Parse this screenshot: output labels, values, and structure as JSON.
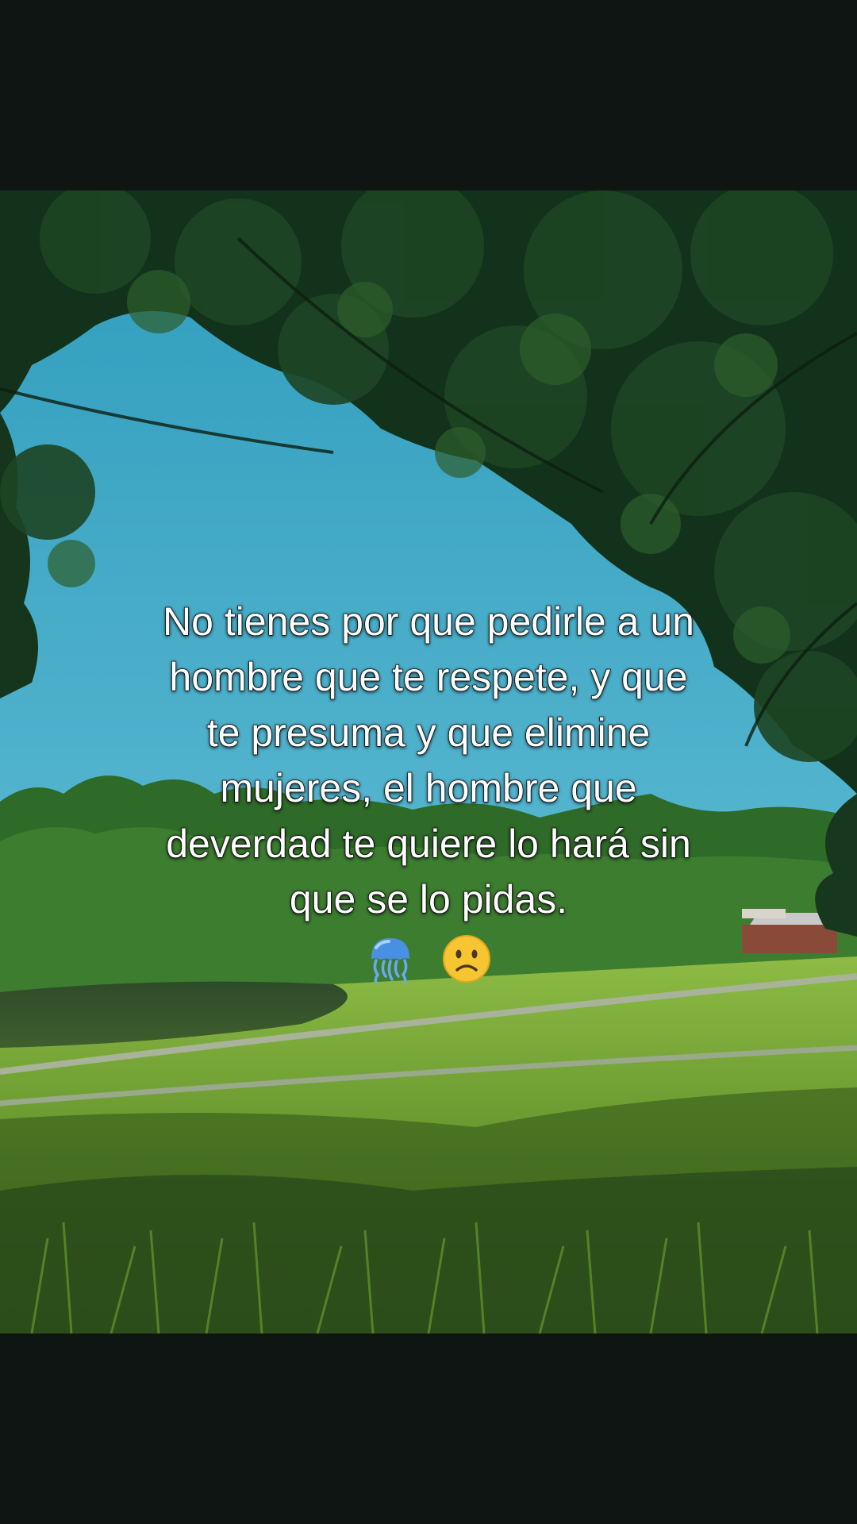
{
  "caption": {
    "lines": [
      "No tienes por que pedirle a un",
      "hombre que te respete, y que",
      "te presuma y que elimine",
      "mujeres, el hombre que",
      "deverdad te quiere lo hará sin",
      "que se lo pidas."
    ]
  },
  "emojis": [
    "jellyfish-emoji",
    "slightly-frowning-face-emoji"
  ],
  "colors": {
    "background": "#0e1512",
    "sky": "#3aa6c4",
    "foliage": "#12301a",
    "grass": "#7fae3c",
    "caption_text": "#ffffff"
  }
}
